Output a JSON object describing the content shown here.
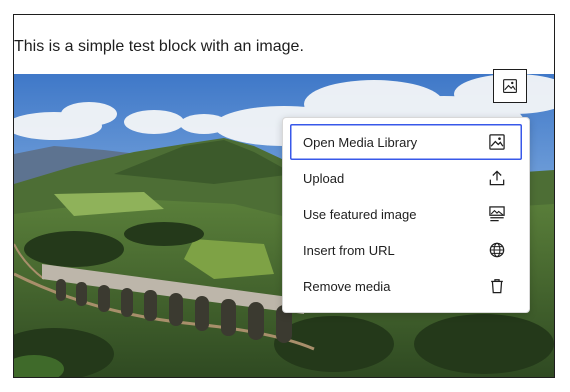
{
  "paragraph": {
    "text": "This is a simple test block with an image."
  },
  "toolbar": {
    "replace_icon": "image-icon"
  },
  "media_menu": {
    "items": [
      {
        "label": "Open Media Library",
        "icon": "image-icon",
        "focused": true
      },
      {
        "label": "Upload",
        "icon": "upload-icon"
      },
      {
        "label": "Use featured image",
        "icon": "featured-image-icon"
      },
      {
        "label": "Insert from URL",
        "icon": "globe-icon"
      },
      {
        "label": "Remove media",
        "icon": "trash-icon"
      }
    ]
  },
  "colors": {
    "focus": "#3858e9",
    "text": "#1e1e1e",
    "border": "#1e1e1e"
  }
}
